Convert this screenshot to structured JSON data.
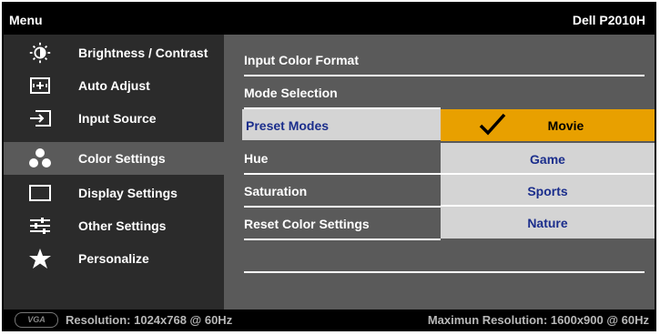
{
  "header": {
    "title": "Menu",
    "model": "Dell P2010H"
  },
  "sidebar": {
    "items": [
      {
        "label": "Brightness / Contrast",
        "icon": "sun-icon"
      },
      {
        "label": "Auto Adjust",
        "icon": "auto-adjust-icon"
      },
      {
        "label": "Input Source",
        "icon": "input-source-icon"
      },
      {
        "label": "Color Settings",
        "icon": "color-dots-icon",
        "active": true
      },
      {
        "label": "Display Settings",
        "icon": "display-rect-icon"
      },
      {
        "label": "Other Settings",
        "icon": "sliders-icon"
      },
      {
        "label": "Personalize",
        "icon": "star-icon"
      }
    ]
  },
  "content": {
    "rows": [
      {
        "label": "Input Color Format"
      },
      {
        "label": "Mode Selection"
      },
      {
        "label": "Preset Modes",
        "selected": true
      },
      {
        "label": "Hue"
      },
      {
        "label": "Saturation"
      },
      {
        "label": "Reset Color Settings"
      }
    ]
  },
  "submenu": {
    "options": [
      {
        "label": "Movie",
        "checked": true
      },
      {
        "label": "Game"
      },
      {
        "label": "Sports"
      },
      {
        "label": "Nature"
      }
    ]
  },
  "footer": {
    "logo_text": "VGA",
    "resolution": "Resolution: 1024x768 @ 60Hz",
    "max_resolution": "Maximun Resolution: 1600x900 @ 60Hz"
  },
  "colors": {
    "active_option": "#e8a000",
    "selected_text": "#1b2e8c",
    "panel": "#5a5a5a",
    "sidebar": "#2b2b2b"
  }
}
